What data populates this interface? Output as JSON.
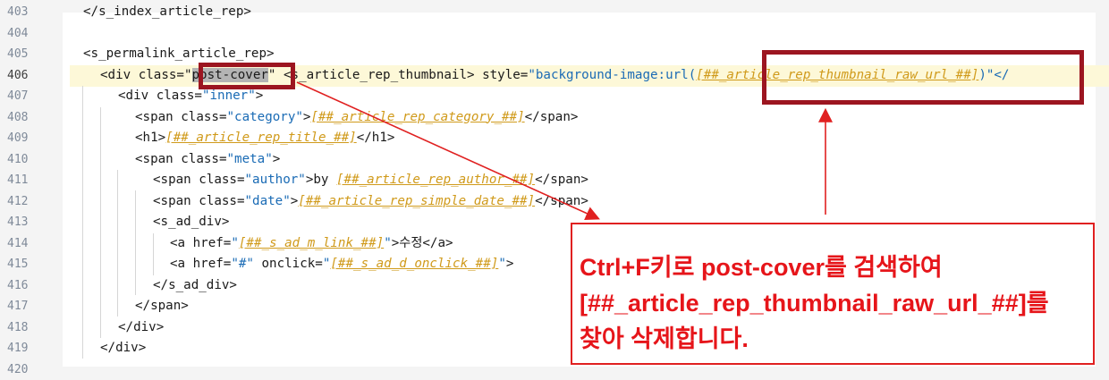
{
  "editor": {
    "line_numbers": [
      "403",
      "404",
      "405",
      "406",
      "407",
      "408",
      "409",
      "410",
      "411",
      "412",
      "413",
      "414",
      "415",
      "416",
      "417",
      "418",
      "419",
      "420"
    ],
    "current_line": "406"
  },
  "code": {
    "l403": "</s_index_article_rep>",
    "l405": "<s_permalink_article_rep>",
    "l406": {
      "p1": "<div class=\"",
      "sel": "post-cover",
      "p2": "\" <s_article_rep_thumbnail> style=",
      "p3": "\"background-image:url(",
      "var": "[##_article_rep_thumbnail_raw_url_##]",
      "p4": ")\"</"
    },
    "l407": {
      "p1": "<div class=",
      "str": "\"inner\"",
      "p2": ">"
    },
    "l408": {
      "p1": "<span class=",
      "str": "\"category\"",
      "p2": ">",
      "var": "[##_article_rep_category_##]",
      "p3": "</span>"
    },
    "l409": {
      "p1": "<h1>",
      "var": "[##_article_rep_title_##]",
      "p2": "</h1>"
    },
    "l410": {
      "p1": "<span class=",
      "str": "\"meta\"",
      "p2": ">"
    },
    "l411": {
      "p1": "<span class=",
      "str": "\"author\"",
      "p2": ">by ",
      "var": "[##_article_rep_author_##]",
      "p3": "</span>"
    },
    "l412": {
      "p1": "<span class=",
      "str": "\"date\"",
      "p2": ">",
      "var": "[##_article_rep_simple_date_##]",
      "p3": "</span>"
    },
    "l413": "<s_ad_div>",
    "l414": {
      "p1": "<a href=",
      "str": "\"",
      "var": "[##_s_ad_m_link_##]",
      "str2": "\"",
      "p2": ">수정</a>"
    },
    "l415": {
      "p1": "<a href=",
      "str": "\"#\"",
      "p2": " onclick=",
      "str2": "\"",
      "var": "[##_s_ad_d_onclick_##]",
      "str3": "\"",
      "p3": ">"
    },
    "l416": "</s_ad_div>",
    "l417": "</span>",
    "l418": "</div>",
    "l419": "</div>"
  },
  "callout": {
    "line1": "Ctrl+F키로 post-cover를 검색하여",
    "line2": "[##_article_rep_thumbnail_raw_url_##]를",
    "line3": "찾아 삭제합니다."
  },
  "colors": {
    "annotation_red": "#e02020",
    "box_red": "#9c1520",
    "string_blue": "#1a6bb5",
    "template_var": "#d09a1a"
  }
}
